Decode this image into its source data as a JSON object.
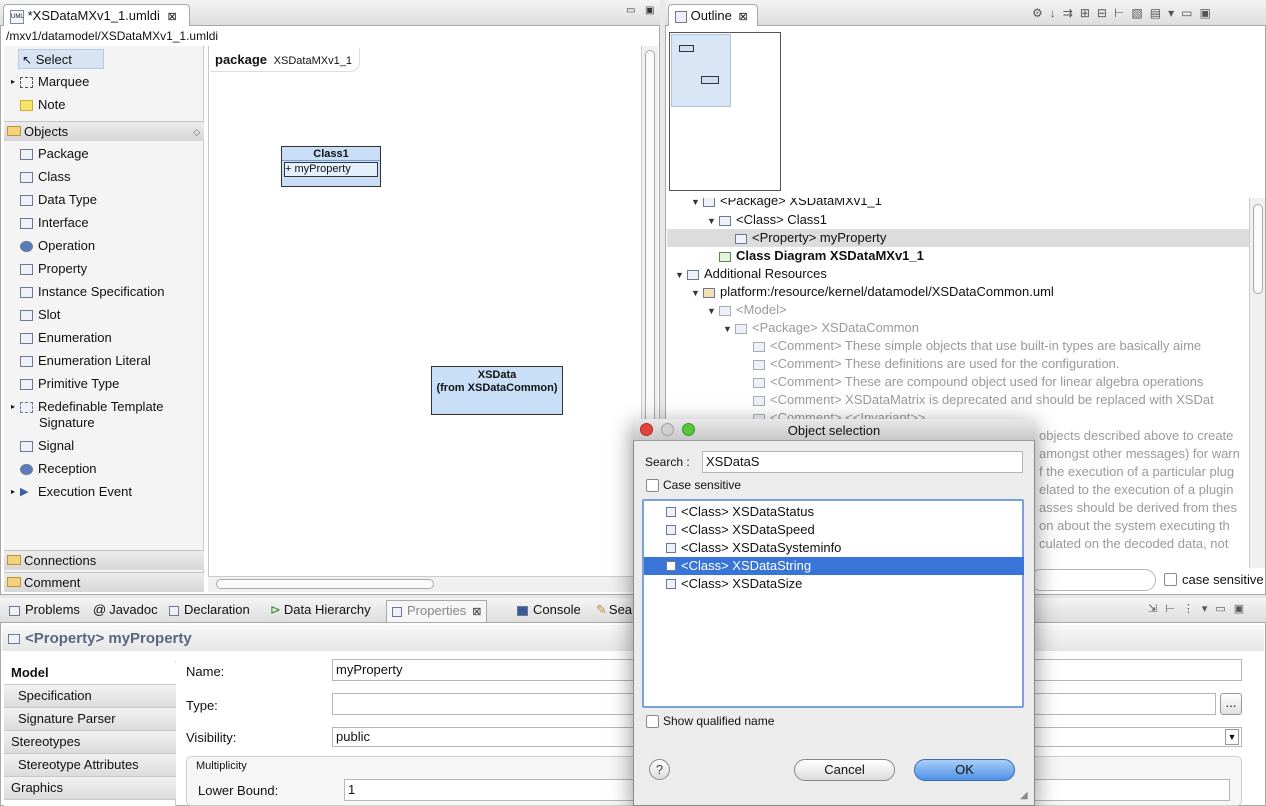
{
  "editor": {
    "tab_title": "*XSDataMXv1_1.umldi",
    "path": "/mxv1/datamodel/XSDataMXv1_1.umldi",
    "badge": "UML"
  },
  "palette": {
    "tools": [
      {
        "label": "Select"
      },
      {
        "label": "Marquee"
      },
      {
        "label": "Note"
      }
    ],
    "objects_drawer": "Objects",
    "objects": [
      {
        "label": "Package"
      },
      {
        "label": "Class"
      },
      {
        "label": "Data Type"
      },
      {
        "label": "Interface"
      },
      {
        "label": "Operation"
      },
      {
        "label": "Property"
      },
      {
        "label": "Instance Specification"
      },
      {
        "label": "Slot"
      },
      {
        "label": "Enumeration"
      },
      {
        "label": "Enumeration Literal"
      },
      {
        "label": "Primitive Type"
      },
      {
        "label": "Redefinable Template"
      },
      {
        "label": "Signature"
      },
      {
        "label": "Signal"
      },
      {
        "label": "Reception"
      },
      {
        "label": "Execution Event"
      }
    ],
    "connections_drawer": "Connections",
    "comment_drawer": "Comment"
  },
  "diagram": {
    "package_keyword": "package",
    "package_name": "XSDataMXv1_1",
    "class1_name": "Class1",
    "class1_property": "+ myProperty",
    "xsdata_name": "XSData",
    "xsdata_from": "(from XSDataCommon)"
  },
  "outline": {
    "tab_title": "Outline",
    "tree": [
      {
        "text": "<Package> XSDataMXv1_1",
        "twisty": "▼"
      },
      {
        "text": "<Class> Class1",
        "twisty": "▼"
      },
      {
        "text": "<Property> myProperty",
        "twisty": ""
      },
      {
        "text": "Class Diagram XSDataMXv1_1",
        "twisty": ""
      },
      {
        "text": "Additional Resources",
        "twisty": "▼"
      },
      {
        "text": "platform:/resource/kernel/datamodel/XSDataCommon.uml",
        "twisty": "▼"
      },
      {
        "text": "<Model>",
        "twisty": "▼"
      },
      {
        "text": "<Package> XSDataCommon",
        "twisty": "▼"
      },
      {
        "text": "<Comment> These simple objects that use built-in types are basically aime",
        "twisty": ""
      },
      {
        "text": "<Comment> These definitions are used for the configuration.",
        "twisty": ""
      },
      {
        "text": "<Comment> These are compound object used for linear algebra operations",
        "twisty": ""
      },
      {
        "text": "<Comment> XSDataMatrix is deprecated and should be replaced with XSDat",
        "twisty": ""
      },
      {
        "text": "<Comment> <<Invariant>>",
        "twisty": ""
      }
    ],
    "behind_lines": [
      "objects described above to create",
      "amongst other messages) for warn",
      "f the execution of a particular plug",
      "elated to the execution of a plugin",
      "asses should be derived from thes",
      "on about the system executing th",
      "culated on the decoded data, not"
    ],
    "case_sensitive_label": "case sensitive"
  },
  "bottom": {
    "tabs": [
      {
        "label": "Problems"
      },
      {
        "label": "Javadoc"
      },
      {
        "label": "Declaration"
      },
      {
        "label": "Data Hierarchy"
      },
      {
        "label": "Properties"
      },
      {
        "label": "Console"
      },
      {
        "label": "Sea"
      }
    ]
  },
  "properties": {
    "header": "<Property> myProperty",
    "side_tabs": [
      {
        "label": "Model"
      },
      {
        "label": "Specification"
      },
      {
        "label": "Signature Parser"
      },
      {
        "label": "Stereotypes"
      },
      {
        "label": "Stereotype Attributes"
      },
      {
        "label": "Graphics"
      }
    ],
    "name_label": "Name:",
    "name_value": "myProperty",
    "type_label": "Type:",
    "type_value": "",
    "visibility_label": "Visibility:",
    "visibility_value": "public",
    "multiplicity_label": "Multiplicity",
    "lower_bound_label": "Lower Bound:",
    "lower_bound_value": "1",
    "more_button": "..."
  },
  "dialog": {
    "title": "Object selection",
    "search_label": "Search :",
    "search_value": "XSDataS",
    "case_sensitive": "Case sensitive",
    "results": [
      {
        "text": "<Class> XSDataStatus"
      },
      {
        "text": "<Class> XSDataSpeed"
      },
      {
        "text": "<Class> XSDataSysteminfo"
      },
      {
        "text": "<Class> XSDataString"
      },
      {
        "text": "<Class> XSDataSize"
      }
    ],
    "selected_index": 3,
    "show_qualified": "Show qualified name",
    "help": "?",
    "cancel": "Cancel",
    "ok": "OK"
  }
}
